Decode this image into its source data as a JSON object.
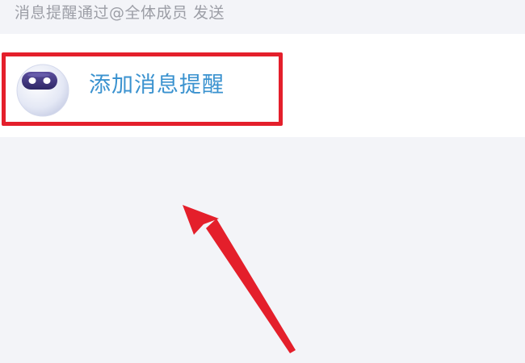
{
  "hint": {
    "text": "消息提醒通过@全体成员 发送"
  },
  "action": {
    "label": "添加消息提醒",
    "icon": "robot-avatar-icon"
  },
  "annotations": {
    "highlight_color": "#e41f2b",
    "arrow_color": "#e41f2b"
  },
  "colors": {
    "background": "#f3f4f8",
    "row_background": "#ffffff",
    "hint_text": "#9c9ea6",
    "link_text": "#3a92cf"
  }
}
